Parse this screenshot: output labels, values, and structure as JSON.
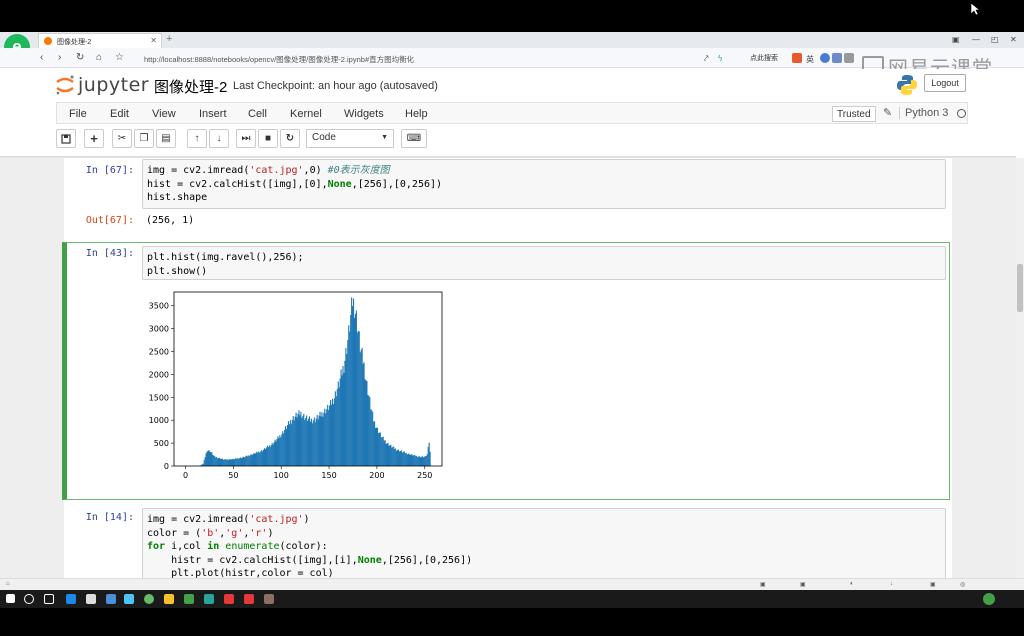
{
  "browser": {
    "tab_title": "图像处理-2",
    "url": "http://localhost:8888/notebooks/opencv/图像处理/图像处理-2.ipynb#直方图均衡化",
    "search_label": "点此搜索",
    "watermark": "网易云课堂"
  },
  "jupyter": {
    "brand": "jupyter",
    "notebook_title": "图像处理-2",
    "checkpoint": "Last Checkpoint: an hour ago (autosaved)",
    "logout_label": "Logout",
    "menu": [
      "File",
      "Edit",
      "View",
      "Insert",
      "Cell",
      "Kernel",
      "Widgets",
      "Help"
    ],
    "trusted_label": "Trusted",
    "kernel_name": "Python 3",
    "cell_type": "Code"
  },
  "cells": {
    "c1": {
      "prompt": "In [67]:",
      "out_prompt": "Out[67]:",
      "output": "(256, 1)"
    },
    "c2": {
      "prompt": "In [43]:"
    },
    "c3": {
      "prompt": "In [14]:"
    }
  },
  "chart_data": {
    "type": "bar",
    "title": "",
    "xlabel": "",
    "ylabel": "",
    "xlim": [
      -12,
      268
    ],
    "ylim": [
      0,
      3800
    ],
    "xticks": [
      0,
      50,
      100,
      150,
      200,
      250
    ],
    "yticks": [
      0,
      500,
      1000,
      1500,
      2000,
      2500,
      3000,
      3500
    ],
    "bar_color": "#1f77b4",
    "x": [
      0,
      8,
      14,
      18,
      20,
      22,
      25,
      30,
      40,
      50,
      60,
      70,
      80,
      90,
      95,
      100,
      105,
      110,
      115,
      120,
      125,
      130,
      135,
      140,
      145,
      150,
      155,
      160,
      165,
      168,
      170,
      172,
      174,
      176,
      178,
      180,
      182,
      184,
      186,
      188,
      190,
      193,
      196,
      200,
      205,
      210,
      215,
      220,
      225,
      230,
      235,
      240,
      245,
      250,
      252,
      253,
      254,
      255
    ],
    "values": [
      0,
      0,
      0,
      50,
      200,
      340,
      330,
      200,
      140,
      150,
      190,
      260,
      340,
      480,
      580,
      700,
      850,
      1000,
      1100,
      1150,
      1050,
      1000,
      1020,
      1100,
      1200,
      1300,
      1500,
      1800,
      2200,
      2600,
      2900,
      3250,
      3600,
      3500,
      3250,
      2950,
      2600,
      2400,
      2200,
      1900,
      1650,
      1300,
      1000,
      800,
      620,
      500,
      420,
      360,
      320,
      280,
      250,
      220,
      200,
      200,
      250,
      450,
      520,
      300
    ]
  }
}
